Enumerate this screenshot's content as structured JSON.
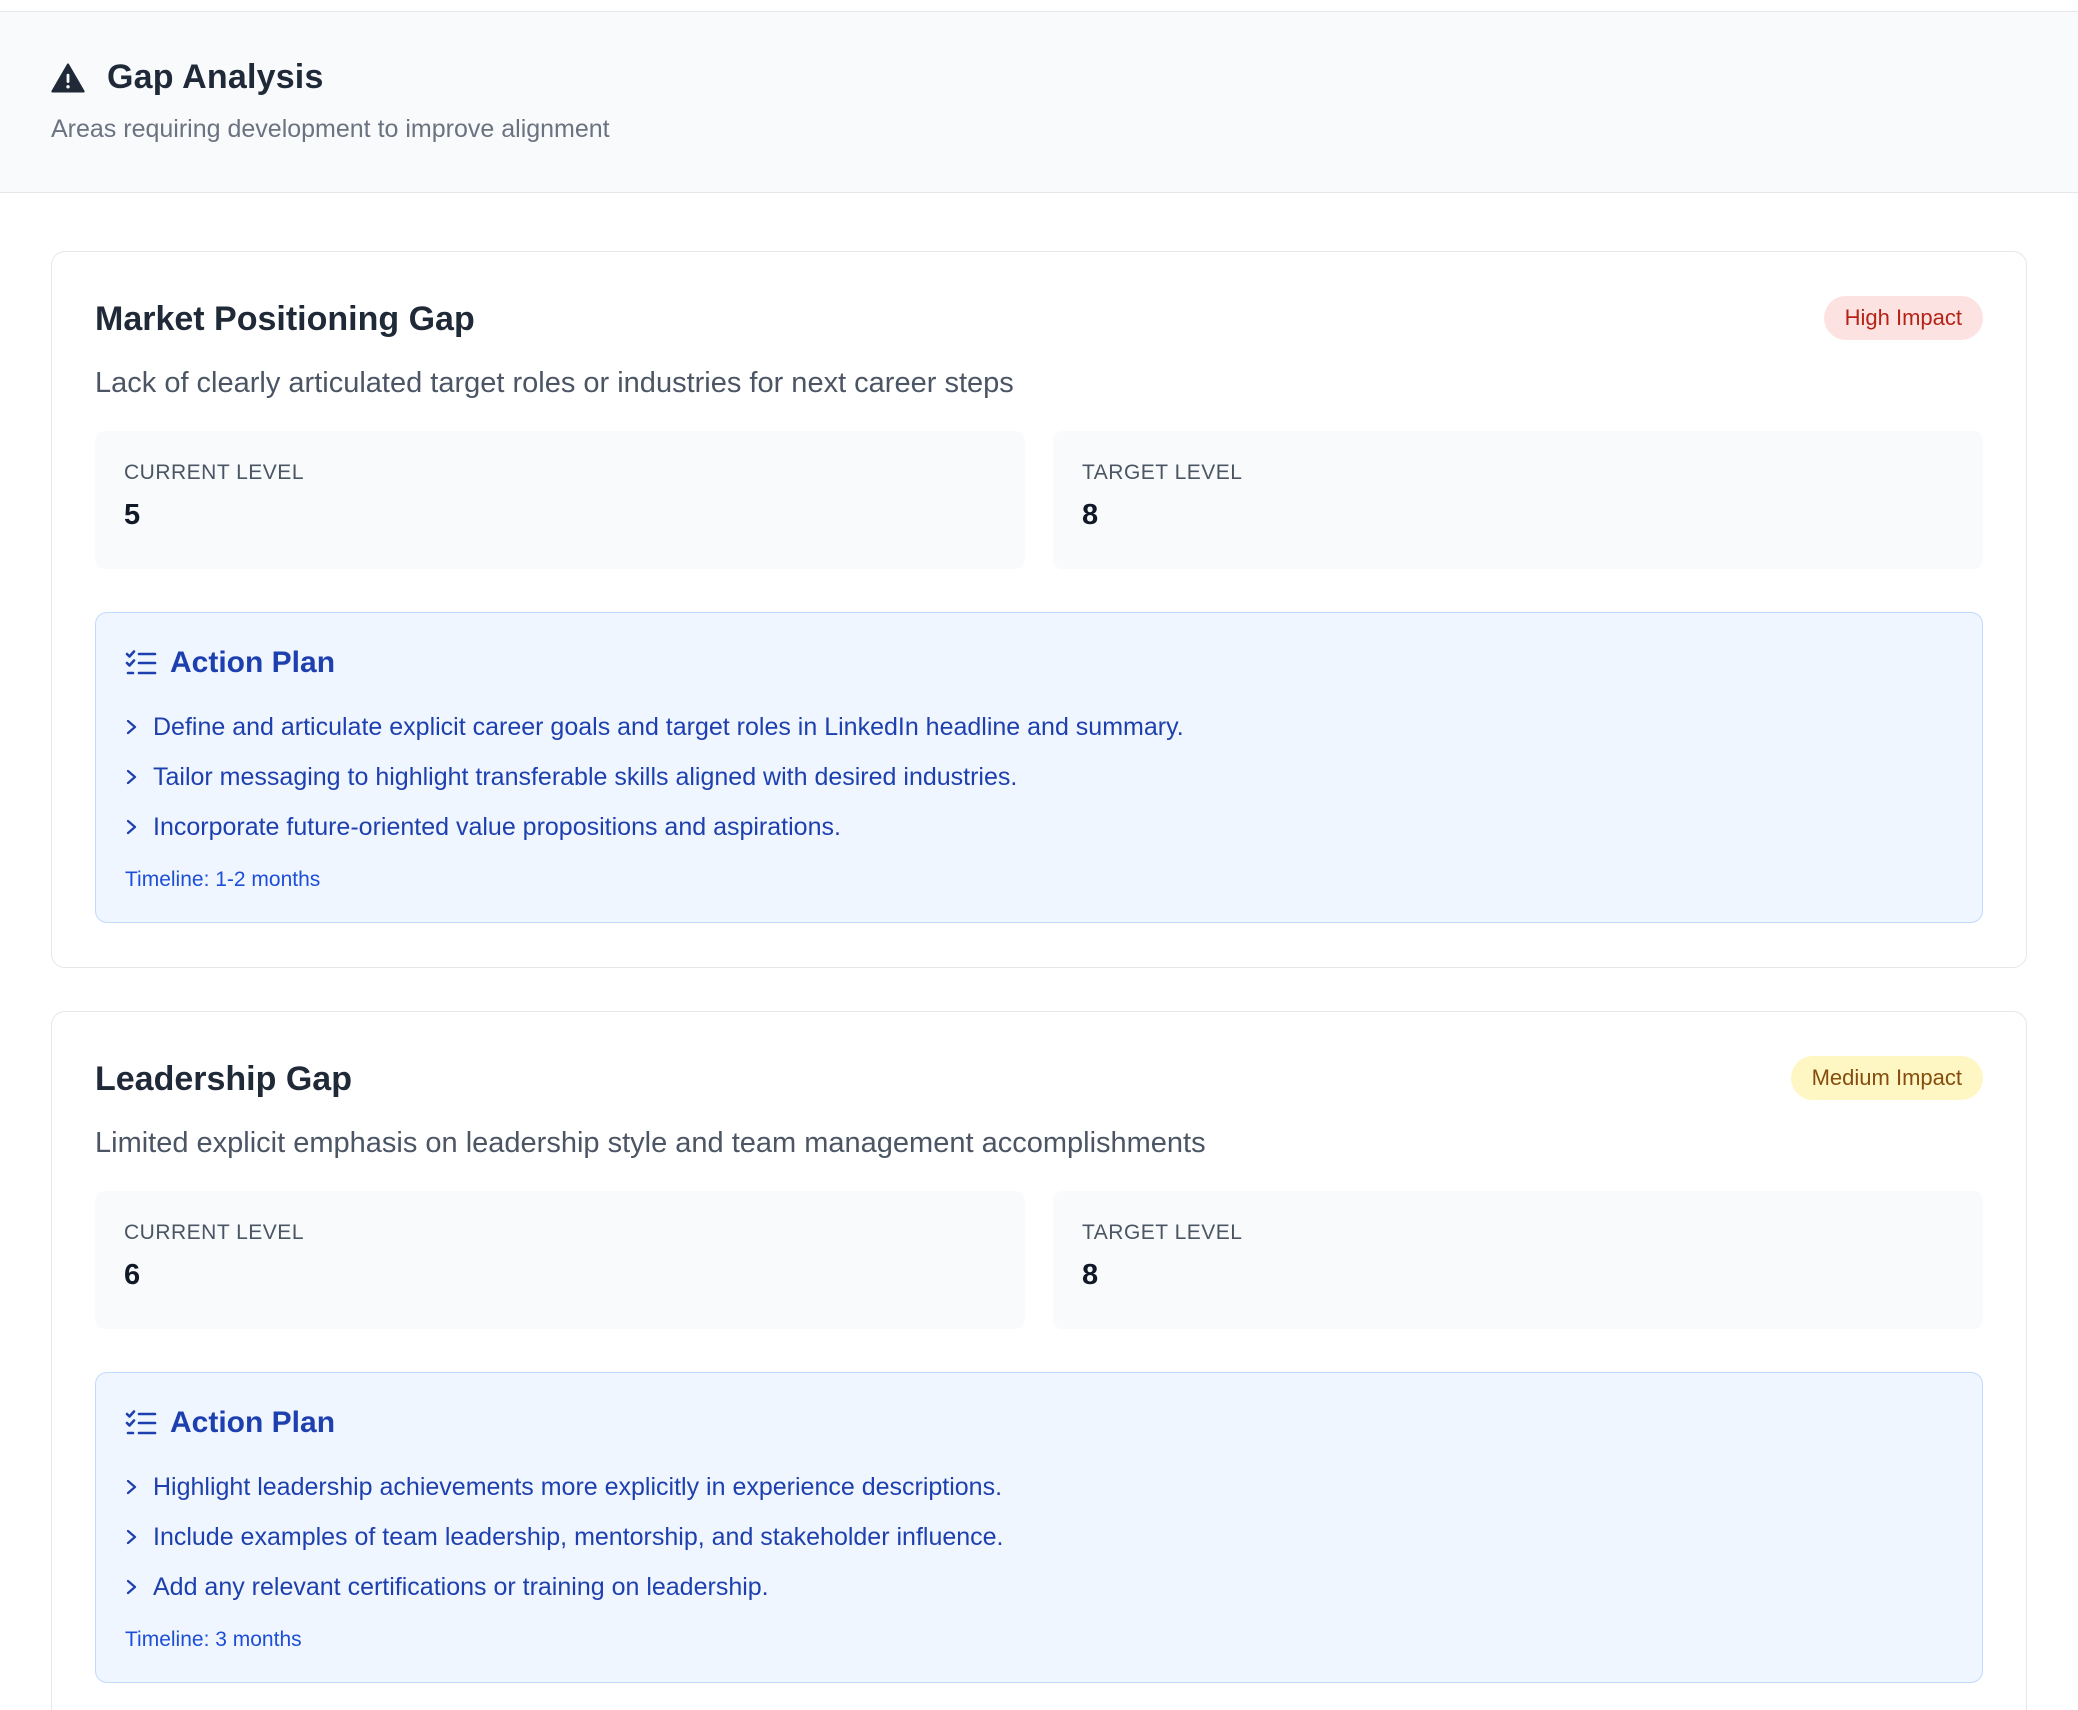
{
  "header": {
    "icon": "warning-triangle-icon",
    "title": "Gap Analysis",
    "subtitle": "Areas requiring development to improve alignment"
  },
  "colors": {
    "accent_blue": "#1e40af",
    "high_impact_bg": "#fde2e2",
    "high_impact_text": "#b42318",
    "medium_impact_bg": "#fef7c3",
    "medium_impact_text": "#854d0e"
  },
  "gaps": [
    {
      "title": "Market Positioning Gap",
      "impact": "High Impact",
      "description": "Lack of clearly articulated target roles or industries for next career steps",
      "current_label": "CURRENT LEVEL",
      "current_value": "5",
      "target_label": "TARGET LEVEL",
      "target_value": "8",
      "plan_title": "Action Plan",
      "plan_icon": "checklist-icon",
      "actions": [
        "Define and articulate explicit career goals and target roles in LinkedIn headline and summary.",
        "Tailor messaging to highlight transferable skills aligned with desired industries.",
        "Incorporate future-oriented value propositions and aspirations."
      ],
      "timeline": "Timeline: 1-2 months"
    },
    {
      "title": "Leadership Gap",
      "impact": "Medium Impact",
      "description": "Limited explicit emphasis on leadership style and team management accomplishments",
      "current_label": "CURRENT LEVEL",
      "current_value": "6",
      "target_label": "TARGET LEVEL",
      "target_value": "8",
      "plan_title": "Action Plan",
      "plan_icon": "checklist-icon",
      "actions": [
        "Highlight leadership achievements more explicitly in experience descriptions.",
        "Include examples of team leadership, mentorship, and stakeholder influence.",
        "Add any relevant certifications or training on leadership."
      ],
      "timeline": "Timeline: 3 months"
    }
  ]
}
